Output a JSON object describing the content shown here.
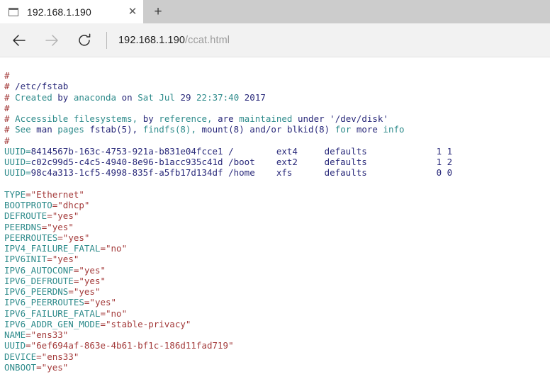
{
  "browser": {
    "tab": {
      "title": "192.168.1.190",
      "favicon_name": "page-icon",
      "close_glyph": "✕"
    },
    "newtab_glyph": "+",
    "nav": {
      "back_name": "back-arrow-icon",
      "forward_name": "forward-arrow-icon",
      "reload_name": "reload-icon"
    },
    "address": {
      "host": "192.168.1.190",
      "path": "/ccat.html",
      "full": "192.168.1.190/ccat.html"
    }
  },
  "page": {
    "fstab": {
      "comments": [
        {
          "hash": "#",
          "rest": ""
        },
        {
          "hash": "#",
          "rest": " /etc/fstab"
        },
        {
          "hash": "#",
          "rest": " Created by anaconda on Sat Jul 29 22:37:40 2017"
        },
        {
          "hash": "#",
          "rest": ""
        },
        {
          "hash": "#",
          "rest": " Accessible filesystems, by reference, are maintained under '/dev/disk'"
        },
        {
          "hash": "#",
          "rest": " See man pages fstab(5), findfs(8), mount(8) and/or blkid(8) for more info"
        },
        {
          "hash": "#",
          "rest": ""
        }
      ],
      "comment_lines": [
        "#",
        "# /etc/fstab",
        "# Created by anaconda on Sat Jul 29 22:37:40 2017",
        "#",
        "# Accessible filesystems, by reference, are maintained under '/dev/disk'",
        "# See man pages fstab(5), findfs(8), mount(8) and/or blkid(8) for more info",
        "#"
      ],
      "entries": [
        {
          "key": "UUID=",
          "uuid": "8414567b-163c-4753-921a-b831e04fcce1",
          "mountpoint": "/",
          "type": "ext4",
          "options": "defaults",
          "dump": "1",
          "pass": "1"
        },
        {
          "key": "UUID=",
          "uuid": "c02c99d5-c4c5-4940-8e96-b1acc935c41d",
          "mountpoint": "/boot",
          "type": "ext2",
          "options": "defaults",
          "dump": "1",
          "pass": "2"
        },
        {
          "key": "UUID=",
          "uuid": "98c4a313-1cf5-4998-835f-a5fb17d134df",
          "mountpoint": "/home",
          "type": "xfs",
          "options": "defaults",
          "dump": "0",
          "pass": "0"
        }
      ]
    },
    "ifcfg": [
      {
        "key": "TYPE",
        "value": "=\"Ethernet\""
      },
      {
        "key": "BOOTPROTO",
        "value": "=\"dhcp\""
      },
      {
        "key": "DEFROUTE",
        "value": "=\"yes\""
      },
      {
        "key": "PEERDNS",
        "value": "=\"yes\""
      },
      {
        "key": "PEERROUTES",
        "value": "=\"yes\""
      },
      {
        "key": "IPV4_FAILURE_FATAL",
        "value": "=\"no\""
      },
      {
        "key": "IPV6INIT",
        "value": "=\"yes\""
      },
      {
        "key": "IPV6_AUTOCONF",
        "value": "=\"yes\""
      },
      {
        "key": "IPV6_DEFROUTE",
        "value": "=\"yes\""
      },
      {
        "key": "IPV6_PEERDNS",
        "value": "=\"yes\""
      },
      {
        "key": "IPV6_PEERROUTES",
        "value": "=\"yes\""
      },
      {
        "key": "IPV6_FAILURE_FATAL",
        "value": "=\"no\""
      },
      {
        "key": "IPV6_ADDR_GEN_MODE",
        "value": "=\"stable-privacy\""
      },
      {
        "key": "NAME",
        "value": "=\"ens33\""
      },
      {
        "key": "UUID",
        "value": "=\"6ef694af-863e-4b61-bf1c-186d11fad719\""
      },
      {
        "key": "DEVICE",
        "value": "=\"ens33\""
      },
      {
        "key": "ONBOOT",
        "value": "=\"yes\""
      }
    ],
    "colors": {
      "comment_hash": "#a33a3a",
      "teal": "#2e8b8b",
      "navy": "#29297a",
      "red": "#a33a3a",
      "background": "#ffffff"
    }
  }
}
